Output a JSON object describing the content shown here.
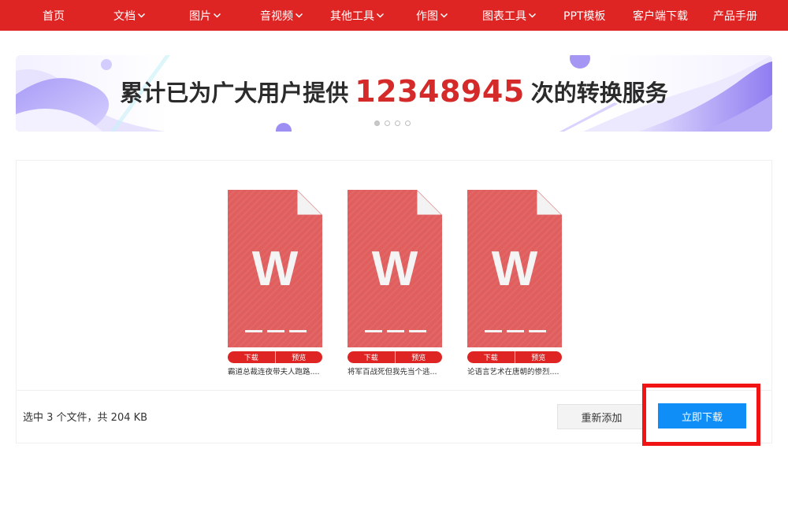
{
  "nav": {
    "items": [
      {
        "label": "首页",
        "dropdown": false
      },
      {
        "label": "文档",
        "dropdown": true
      },
      {
        "label": "图片",
        "dropdown": true
      },
      {
        "label": "音视频",
        "dropdown": true
      },
      {
        "label": "其他工具",
        "dropdown": true
      },
      {
        "label": "作图",
        "dropdown": true
      },
      {
        "label": "图表工具",
        "dropdown": true
      },
      {
        "label": "PPT模板",
        "dropdown": false
      },
      {
        "label": "客户端下载",
        "dropdown": false
      },
      {
        "label": "产品手册",
        "dropdown": false
      }
    ],
    "color": "#df2424"
  },
  "banner": {
    "text_before": "累计已为广大用户提供",
    "count": "12348945",
    "text_after": "次的转换服务",
    "slides": 4,
    "active_slide": 0
  },
  "files": [
    {
      "letter": "W",
      "download_label": "下载",
      "preview_label": "预览",
      "name": "霸道总裁连夜带夫人跑路...."
    },
    {
      "letter": "W",
      "download_label": "下载",
      "preview_label": "预览",
      "name": "将军百战死但我先当个逃..."
    },
    {
      "letter": "W",
      "download_label": "下载",
      "preview_label": "预览",
      "name": "论语言艺术在唐朝的惨烈...."
    }
  ],
  "footer": {
    "status": "选中 3 个文件，共 204 KB",
    "readd_label": "重新添加",
    "download_label": "立即下载"
  },
  "colors": {
    "accent": "#0f8ef7",
    "doc": "#e05e5e",
    "highlight": "#f01414"
  }
}
